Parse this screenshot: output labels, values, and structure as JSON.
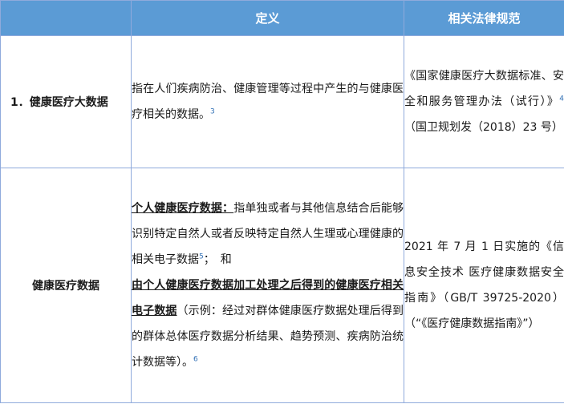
{
  "header": {
    "col0": "",
    "col1": "定义",
    "col2": "相关法律规范"
  },
  "rows": [
    {
      "term": "1．健康医疗大数据",
      "definition": {
        "text": "指在人们疾病防治、健康管理等过程中产生的与健康医疗相关的数据。",
        "fn": "3"
      },
      "law": {
        "text": "《国家健康医疗大数据标准、安全和服务管理办法（试行）》",
        "fn": "4",
        "tail": "（国卫规划发（2018）23 号）"
      }
    },
    {
      "term": "健康医疗数据",
      "definition": {
        "bold1": "个人健康医疗数据：",
        "text1": "指单独或者与其他信息结合后能够识别特定自然人或者反映特定自然人生理或心理健康的相关电子数据",
        "fn1": "5",
        "text2": "；　和",
        "bold2": "由个人健康医疗数据加工处理之后得到的健康医疗相关电子数据",
        "text3": "（示例：经过对群体健康医疗数据处理后得到的群体总体医疗数据分析结果、趋势预测、疾病防治统计数据等）。",
        "fn2": "6"
      },
      "law": {
        "text": "2021 年 7 月 1 日实施的《信息安全技术 医疗健康数据安全指南》（GB/T 39725-2020）（“《医疗健康数据指南》”）"
      }
    }
  ]
}
